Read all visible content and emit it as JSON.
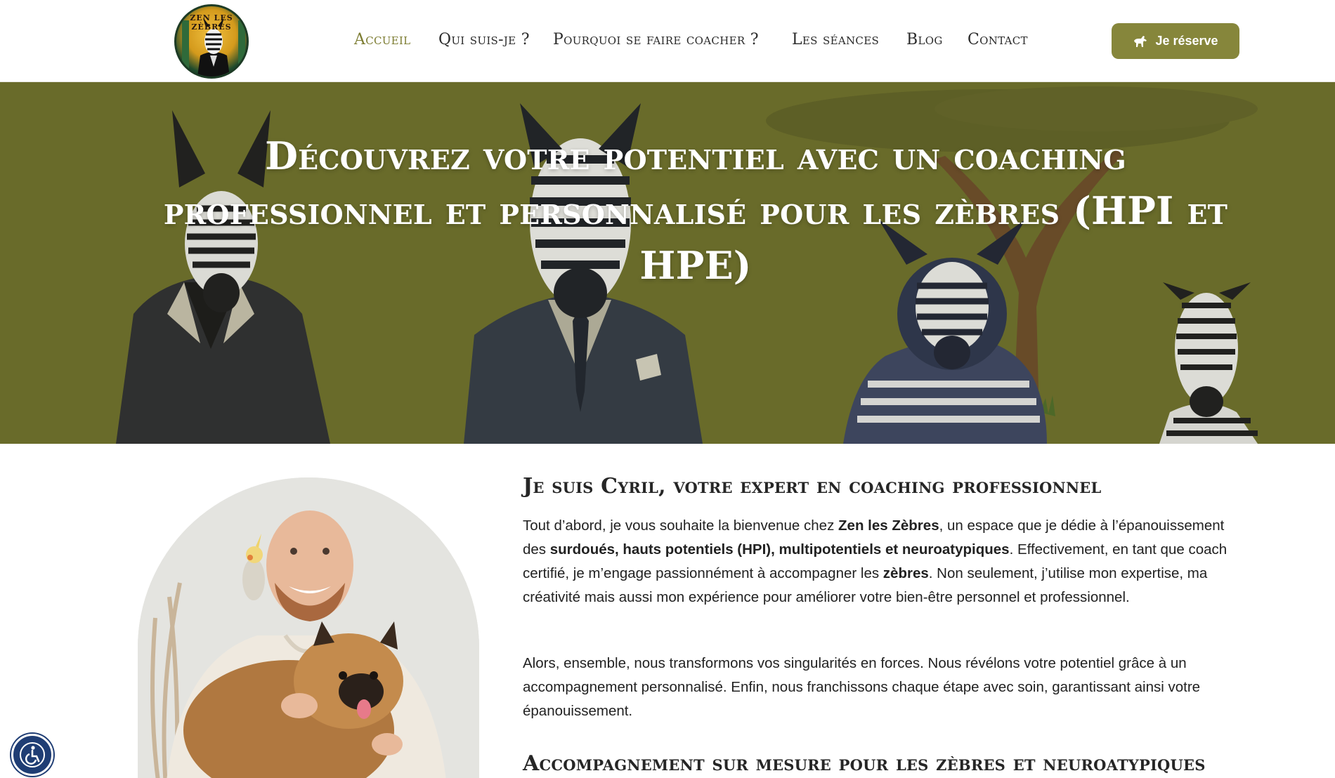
{
  "header": {
    "logo_text": "ZEN LES ZÈBRES",
    "nav": [
      {
        "label": "Accueil",
        "active": true
      },
      {
        "label": "Qui suis-je ?",
        "active": false
      },
      {
        "label": "Pourquoi se faire coacher ?",
        "active": false
      },
      {
        "label": "Les séances",
        "active": false
      },
      {
        "label": "Blog",
        "active": false
      },
      {
        "label": "Contact",
        "active": false
      }
    ],
    "cta_label": "Je réserve"
  },
  "hero": {
    "title_line1": "Découvrez votre potentiel avec un coaching",
    "title_line2": "professionnel et personnalisé pour les zèbres (HPI et",
    "title_line3": "HPE)"
  },
  "intro": {
    "heading": "Je suis Cyril, votre expert en coaching professionnel",
    "p1": {
      "t1": "Tout d’abord, je vous souhaite la bienvenue chez ",
      "b1": "Zen les Zèbres",
      "t2": ", un espace que je dédie à l’épanouissement des ",
      "b2": "surdoués, hauts potentiels (HPI), multipotentiels et neuroatypiques",
      "t3": ". Effectivement, en tant que coach certifié, je m’engage passionnément à accompagner les ",
      "b3": "zèbres",
      "t4": ". Non seulement, j’utilise mon expertise, ma créativité mais aussi mon expérience pour améliorer votre bien-être personnel et professionnel."
    },
    "p2": "Alors, ensemble, nous transformons vos singularités en forces. Nous révélons votre potentiel grâce à un accompagnement personnalisé. Enfin, nous franchissons chaque étape avec soin, garantissant ainsi votre épanouissement."
  },
  "section2": {
    "heading": "Accompagnement sur mesure pour les zèbres et neuroatypiques"
  },
  "colors": {
    "accent": "#86863b",
    "active_nav": "#7c7c31",
    "hero_bg": "#6d6f2c",
    "a11y_button": "#1f3d74"
  },
  "icons": {
    "cta": "horse-icon",
    "a11y": "wheelchair-icon"
  }
}
